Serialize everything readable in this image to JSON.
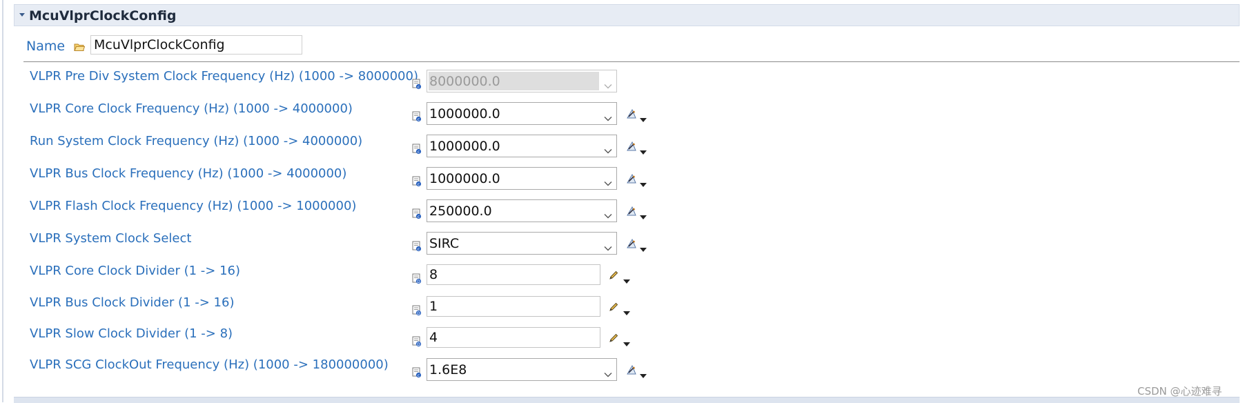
{
  "section": {
    "title": "McuVlprClockConfig"
  },
  "name_field": {
    "label": "Name",
    "value": "McuVlprClockConfig"
  },
  "params": [
    {
      "label": "VLPR Pre Div System Clock Frequency (Hz) (1000 -> 8000000)",
      "value": "8000000.0",
      "control": "combo",
      "disabled": true
    },
    {
      "label": "VLPR Core Clock Frequency (Hz) (1000 -> 4000000)",
      "value": "1000000.0",
      "control": "combo"
    },
    {
      "label": "Run System Clock Frequency (Hz) (1000 -> 4000000)",
      "value": "1000000.0",
      "control": "combo"
    },
    {
      "label": "VLPR Bus Clock Frequency (Hz) (1000 -> 4000000)",
      "value": "1000000.0",
      "control": "combo"
    },
    {
      "label": "VLPR Flash Clock Frequency (Hz) (1000 -> 1000000)",
      "value": "250000.0",
      "control": "combo"
    },
    {
      "label": "VLPR System Clock Select",
      "value": "SIRC",
      "control": "combo"
    },
    {
      "label": "VLPR Core Clock Divider (1 -> 16)",
      "value": "8",
      "control": "text"
    },
    {
      "label": "VLPR Bus Clock Divider (1 -> 16)",
      "value": "1",
      "control": "text"
    },
    {
      "label": "VLPR Slow Clock Divider (1 -> 8)",
      "value": "4",
      "control": "text"
    },
    {
      "label": "VLPR SCG ClockOut Frequency (Hz) (1000 -> 180000000)",
      "value": "1.6E8",
      "control": "combo"
    }
  ],
  "watermark": "CSDN @心迹难寻",
  "icons": {
    "twist": "collapse-triangle-icon",
    "name": "folder-icon",
    "param": "parameter-config-icon",
    "calc": "calculate-icon",
    "edit": "pencil-icon",
    "menu": "dropdown-arrow-icon"
  },
  "colors": {
    "label": "#2a6fbb",
    "header_bg": "#e7ecf4",
    "disabled_bg": "#dedede"
  }
}
